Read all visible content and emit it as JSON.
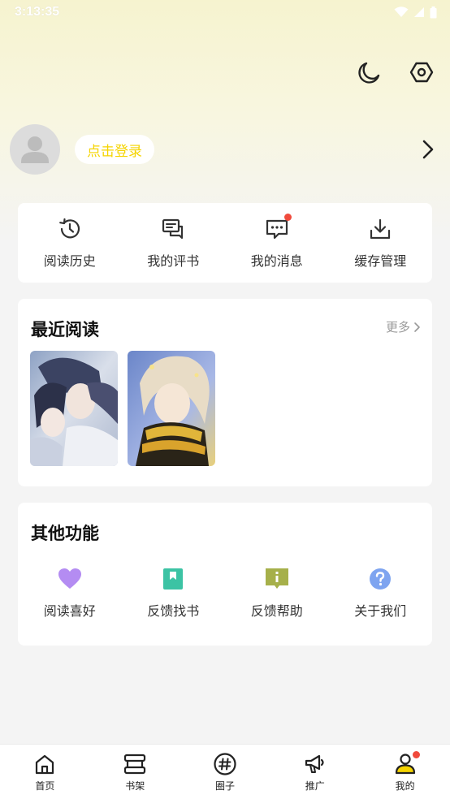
{
  "status_bar": {
    "time": "3:13:35"
  },
  "profile": {
    "login_label": "点击登录"
  },
  "quick_actions": [
    {
      "label": "阅读历史",
      "icon": "history-icon"
    },
    {
      "label": "我的评书",
      "icon": "comment-book-icon"
    },
    {
      "label": "我的消息",
      "icon": "message-icon",
      "badge": true
    },
    {
      "label": "缓存管理",
      "icon": "download-icon"
    }
  ],
  "recent": {
    "title": "最近阅读",
    "more_label": "更多",
    "covers": [
      "cover-1",
      "cover-2"
    ]
  },
  "other": {
    "title": "其他功能",
    "items": [
      {
        "label": "阅读喜好",
        "icon": "heart-icon",
        "color": "#b48cf2"
      },
      {
        "label": "反馈找书",
        "icon": "bookmark-icon",
        "color": "#3cc3a4"
      },
      {
        "label": "反馈帮助",
        "icon": "info-icon",
        "color": "#a6b04a"
      },
      {
        "label": "关于我们",
        "icon": "question-icon",
        "color": "#7ea4f0"
      }
    ]
  },
  "tabs": [
    {
      "label": "首页",
      "icon": "home-icon"
    },
    {
      "label": "书架",
      "icon": "bookshelf-icon"
    },
    {
      "label": "圈子",
      "icon": "hashtag-icon"
    },
    {
      "label": "推广",
      "icon": "megaphone-icon"
    },
    {
      "label": "我的",
      "icon": "user-icon",
      "badge": true,
      "active": true
    }
  ],
  "colors": {
    "accent": "#f5d400",
    "badge": "#f04a3c",
    "top_gradient": "#f6f3cf"
  }
}
